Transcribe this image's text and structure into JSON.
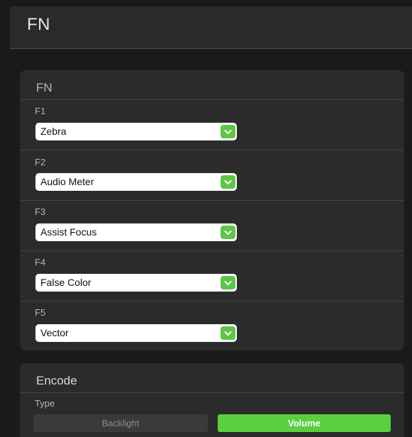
{
  "header": {
    "title": "FN"
  },
  "fn_panel": {
    "title": "FN",
    "rows": [
      {
        "label": "F1",
        "value": "Zebra"
      },
      {
        "label": "F2",
        "value": "Audio Meter"
      },
      {
        "label": "F3",
        "value": "Assist Focus"
      },
      {
        "label": "F4",
        "value": "False Color"
      },
      {
        "label": "F5",
        "value": "Vector"
      }
    ]
  },
  "encode_panel": {
    "title": "Encode",
    "type_label": "Type",
    "options": [
      {
        "label": "Backlight",
        "selected": false
      },
      {
        "label": "Volume",
        "selected": true
      }
    ]
  },
  "colors": {
    "accent": "#5fc64a",
    "selected_segment": "#58d03f",
    "background": "#1a1a1a",
    "panel": "#2b2b2b"
  },
  "icons": {
    "dropdown": "chevron-down-icon"
  }
}
